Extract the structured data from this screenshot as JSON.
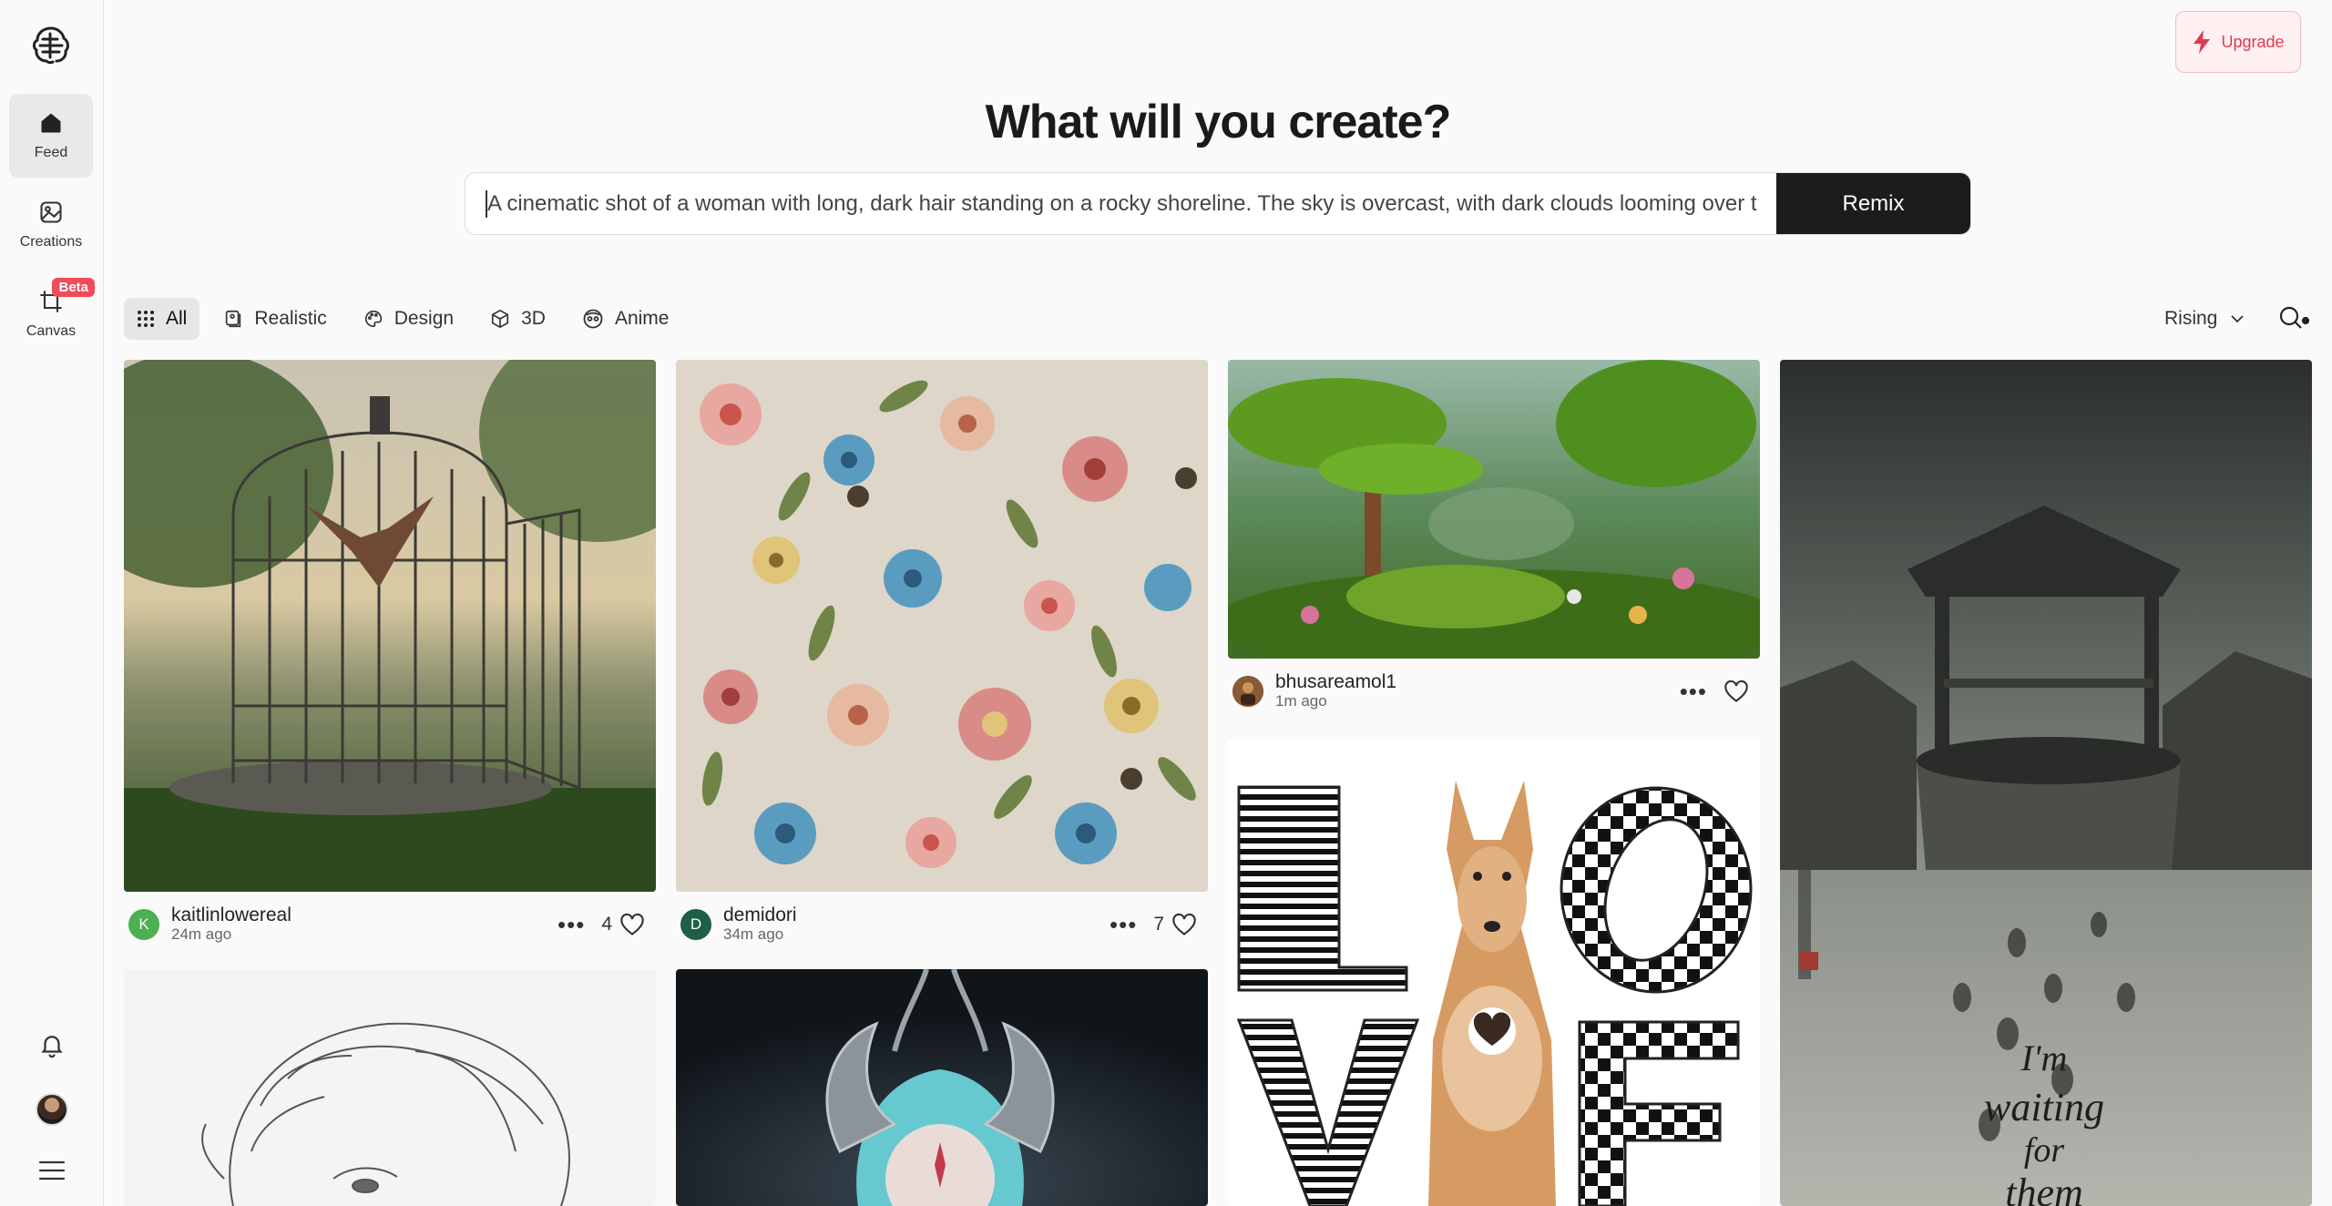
{
  "sidebar": {
    "items": [
      {
        "label": "Feed",
        "icon": "home-icon",
        "active": true
      },
      {
        "label": "Creations",
        "icon": "image-icon"
      },
      {
        "label": "Canvas",
        "icon": "canvas-crop-icon",
        "badge": "Beta"
      }
    ]
  },
  "header": {
    "upgrade_label": "Upgrade",
    "title": "What will you create?",
    "prompt_value": "A cinematic shot of a woman with long, dark hair standing on a rocky shoreline. The sky is overcast, with dark clouds looming over the h",
    "remix_label": "Remix"
  },
  "filters": {
    "tabs": [
      {
        "label": "All",
        "icon": "grid-icon",
        "active": true
      },
      {
        "label": "Realistic",
        "icon": "realistic-icon"
      },
      {
        "label": "Design",
        "icon": "palette-icon"
      },
      {
        "label": "3D",
        "icon": "cube-icon"
      },
      {
        "label": "Anime",
        "icon": "anime-face-icon"
      }
    ],
    "sort_label": "Rising"
  },
  "feed": {
    "cards": [
      {
        "user": "kaitlinlowereal",
        "initial": "K",
        "time": "24m ago",
        "likes": "4",
        "avatar_color": "#4caf50",
        "image": "birdcage-photo"
      },
      {
        "user": "demidori",
        "initial": "D",
        "time": "34m ago",
        "likes": "7",
        "avatar_color": "#1f5f43",
        "image": "floral-pattern"
      },
      {
        "user": "bhusareamol1",
        "initial": "",
        "time": "1m ago",
        "likes": "",
        "avatar_color": "#7a4a2a",
        "image": "3d-forest-scene"
      },
      {
        "image": "love-dog-poster"
      },
      {
        "image": "village-well-sketch",
        "caption": "I'm waiting for them"
      },
      {
        "image": "woman-sketch"
      },
      {
        "image": "fantasy-character"
      }
    ]
  },
  "colors": {
    "accent": "#e23b4e",
    "remix_bg": "#1c1c1c",
    "beta": "#ef4b5a"
  }
}
